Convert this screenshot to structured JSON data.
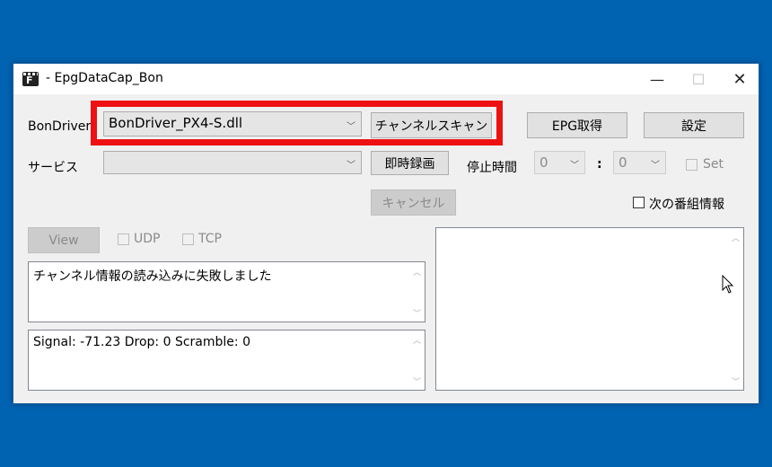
{
  "window": {
    "title": "- EpgDataCap_Bon",
    "minimize": "—",
    "maximize": "☐",
    "close": "✕"
  },
  "bondriver": {
    "label": "BonDriver",
    "selected": "BonDriver_PX4-S.dll",
    "arrow": "﹀",
    "scan_button": "チャンネルスキャン"
  },
  "epg_button": "EPG取得",
  "settings_button": "設定",
  "service": {
    "label": "サービス",
    "selected": "",
    "arrow": "﹀"
  },
  "record_button": "即時録画",
  "stop_time": {
    "label": "停止時間",
    "hour": "0",
    "minute": "0",
    "separator": ":",
    "arrow": "﹀",
    "set_label": "Set"
  },
  "cancel_button": "キャンセル",
  "next_program_label": "次の番組情報",
  "view_button": "View",
  "udp_label": "UDP",
  "tcp_label": "TCP",
  "log_text": "チャンネル情報の読み込みに失敗しました",
  "status_text": "Signal: -71.23 Drop: 0 Scramble: 0",
  "scroll": {
    "up": "︿",
    "down": "﹀"
  },
  "colors": {
    "highlight": "#ee1111",
    "desktop": "#0063b1"
  }
}
